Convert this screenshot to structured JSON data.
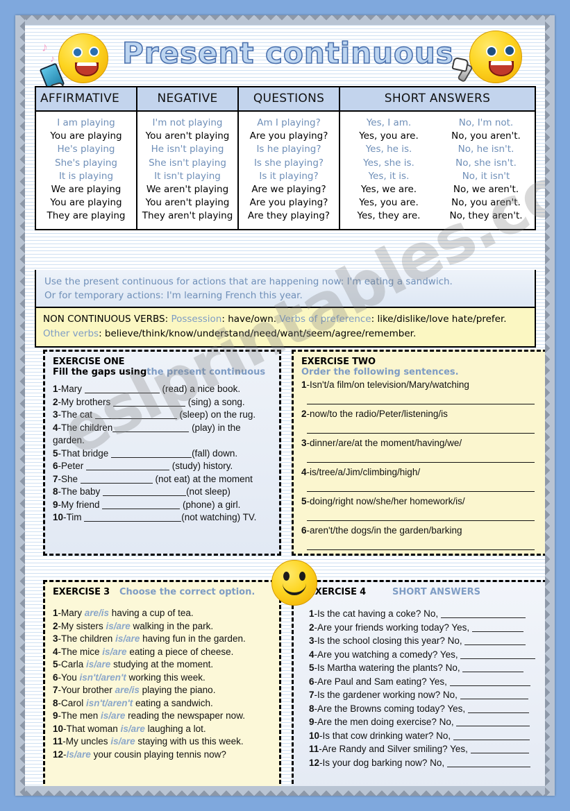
{
  "page": {
    "background_color": "#7fa8dd",
    "paper_color": "#ffffff",
    "watermark": "eslprintables.com"
  },
  "header": {
    "title": "Present continuous",
    "title_fill": "#bdd5f0",
    "title_outline": "#4a70ad",
    "left_icon": "smiley-with-phone-icon",
    "right_icon": "smiley-with-microphone-icon",
    "music_note": "♪"
  },
  "grammar_table": {
    "headers": [
      "AFFIRMATIVE",
      "NEGATIVE",
      "QUESTIONS",
      "SHORT ANSWERS"
    ],
    "header_bg": "#c3d4ed",
    "blue_text": "#6f8fb8",
    "affirmative": [
      "I am playing",
      "You are playing",
      "He's playing",
      "She's playing",
      "It is playing",
      "We are playing",
      "You are playing",
      "They are playing"
    ],
    "negative": [
      "I'm not playing",
      "You aren't playing",
      "He isn't playing",
      "She isn't playing",
      "It isn't playing",
      "We aren't playing",
      "You aren't playing",
      "They aren't playing"
    ],
    "questions": [
      "Am I playing?",
      "Are you playing?",
      "Is he playing?",
      "Is she playing?",
      "Is it playing?",
      "Are we playing?",
      "Are you playing?",
      "Are they playing?"
    ],
    "short_answers_yes": [
      "Yes, I am.",
      "Yes, you are.",
      "Yes, he is.",
      "Yes, she is.",
      "Yes, it is.",
      "Yes, we are.",
      "Yes, you are.",
      "Yes, they are."
    ],
    "short_answers_no": [
      "No, I'm not.",
      "No, you aren't.",
      "No, he isn't.",
      "No, she isn't.",
      "No, it isn't",
      "No, we aren't.",
      "No, you aren't.",
      "No, they aren't."
    ],
    "row_is_blue": [
      true,
      false,
      true,
      true,
      true,
      false,
      false,
      false
    ]
  },
  "usage": {
    "line1": "Use the present continuous for actions that are happening now: I'm eating a sandwich.",
    "line2": "Or for temporary actions: I'm learning French this year."
  },
  "non_continuous": {
    "title": "NON CONTINUOUS VERBS:",
    "possession_label": "Possession",
    "possession_verbs": ": have/own.",
    "preference_label": "Verbs of preference",
    "preference_verbs": ": like/dislike/love hate/prefer.",
    "other_label": "Other verbs",
    "other_verbs": ": believe/think/know/understand/need/want/seem/agree/remember."
  },
  "exercise_one": {
    "title": "EXERCISE ONE",
    "instruction_plain": "Fill the gaps using",
    "instruction_accent": "the present continuous",
    "items": [
      {
        "n": "1",
        "before": "-Mary ",
        "blank": 108,
        "after": " (read) a nice book."
      },
      {
        "n": "2",
        "before": "-My brothers ",
        "blank": 104,
        "after": " (sing) a song."
      },
      {
        "n": "3",
        "before": "-The cat ",
        "blank": 118,
        "after": " (sleep) on the rug."
      },
      {
        "n": "4",
        "before": "-The children",
        "blank": 110,
        "after": " (play) in the"
      },
      {
        "n": "",
        "before": "garden.",
        "blank": 0,
        "after": ""
      },
      {
        "n": "5",
        "before": "-That bridge ",
        "blank": 116,
        "after": "(fall) down."
      },
      {
        "n": "6",
        "before": "-Peter ",
        "blank": 120,
        "after": " (study) history."
      },
      {
        "n": "7",
        "before": "-She ",
        "blank": 104,
        "after": " (not eat) at the moment"
      },
      {
        "n": "8",
        "before": "-The baby ",
        "blank": 120,
        "after": "(not sleep)"
      },
      {
        "n": "9",
        "before": "-My friend ",
        "blank": 112,
        "after": " (phone) a girl."
      },
      {
        "n": "10",
        "before": "-Tim ",
        "blank": 140,
        "after": "(not watching) TV."
      }
    ]
  },
  "exercise_two": {
    "title": "EXERCISE TWO",
    "instruction": "Order the following sentences.",
    "items": [
      {
        "n": "1",
        "text": "-Isn't/a film/on television/Mary/watching"
      },
      {
        "n": "2",
        "text": "-now/to the radio/Peter/listening/is"
      },
      {
        "n": "3",
        "text": "-dinner/are/at the moment/having/we/"
      },
      {
        "n": "4",
        "text": "-is/tree/a/Jim/climbing/high/"
      },
      {
        "n": "5",
        "text": "-doing/right now/she/her homework/is/"
      },
      {
        "n": "6",
        "text": "-aren't/the dogs/in the garden/barking"
      }
    ]
  },
  "exercise_three": {
    "title": "EXERCISE 3",
    "instruction": "Choose the correct option.",
    "items": [
      {
        "n": "1",
        "before": "-Mary ",
        "option": "are/is",
        "after": " having a cup of tea."
      },
      {
        "n": "2",
        "before": "-My sisters ",
        "option": "is/are",
        "after": " walking in the park."
      },
      {
        "n": "3",
        "before": "-The children ",
        "option": "is/are",
        "after": " having fun in the garden."
      },
      {
        "n": "4",
        "before": "-The mice ",
        "option": "is/are",
        "after": " eating a piece of cheese."
      },
      {
        "n": "5",
        "before": "-Carla ",
        "option": "is/are",
        "after": " studying at the moment."
      },
      {
        "n": "6",
        "before": "-You ",
        "option": "isn't/aren't",
        "after": " working this week."
      },
      {
        "n": "7",
        "before": "-Your brother ",
        "option": "are/is",
        "after": " playing the piano."
      },
      {
        "n": "8",
        "before": "-Carol ",
        "option": "isn't/aren't",
        "after": " eating a sandwich."
      },
      {
        "n": "9",
        "before": "-The men ",
        "option": "is/are",
        "after": " reading the newspaper now."
      },
      {
        "n": "10",
        "before": "-That woman ",
        "option": "is/are",
        "after": " laughing a lot."
      },
      {
        "n": "11",
        "before": "-My uncles ",
        "option": "is/are",
        "after": " staying with us this week."
      },
      {
        "n": "12",
        "before": "-",
        "option": "Is/are",
        "after": " your cousin playing tennis now?"
      }
    ]
  },
  "exercise_four": {
    "title": "EXERCISE 4",
    "instruction": "SHORT ANSWERS",
    "items": [
      {
        "n": "1",
        "text": "-Is the cat having a coke? No,",
        "blank": 122
      },
      {
        "n": "2",
        "text": "-Are your friends working today? Yes,",
        "blank": 74
      },
      {
        "n": "3",
        "text": "-Is the school closing this year? No,",
        "blank": 88
      },
      {
        "n": "4",
        "text": "-Are you watching a comedy? Yes,",
        "blank": 108
      },
      {
        "n": "5",
        "text": "-Is Martha watering the plants? No,",
        "blank": 88
      },
      {
        "n": "6",
        "text": "-Are Paul and Sam eating? Yes,",
        "blank": 116
      },
      {
        "n": "7",
        "text": "-Is the gardener working now? No,",
        "blank": 98
      },
      {
        "n": "8",
        "text": "-Are the Browns coming today? Yes,",
        "blank": 88
      },
      {
        "n": "9",
        "text": "-Are the men doing exercise? No,",
        "blank": 106
      },
      {
        "n": "10",
        "text": "-Is that cow drinking water? No,",
        "blank": 110
      },
      {
        "n": "11",
        "text": "-Are Randy and Silver smiling? Yes,",
        "blank": 84
      },
      {
        "n": "12",
        "text": "-Is your dog barking now? No,",
        "blank": 120
      }
    ]
  },
  "decor": {
    "mid_smiley": "smiley-face-icon"
  }
}
